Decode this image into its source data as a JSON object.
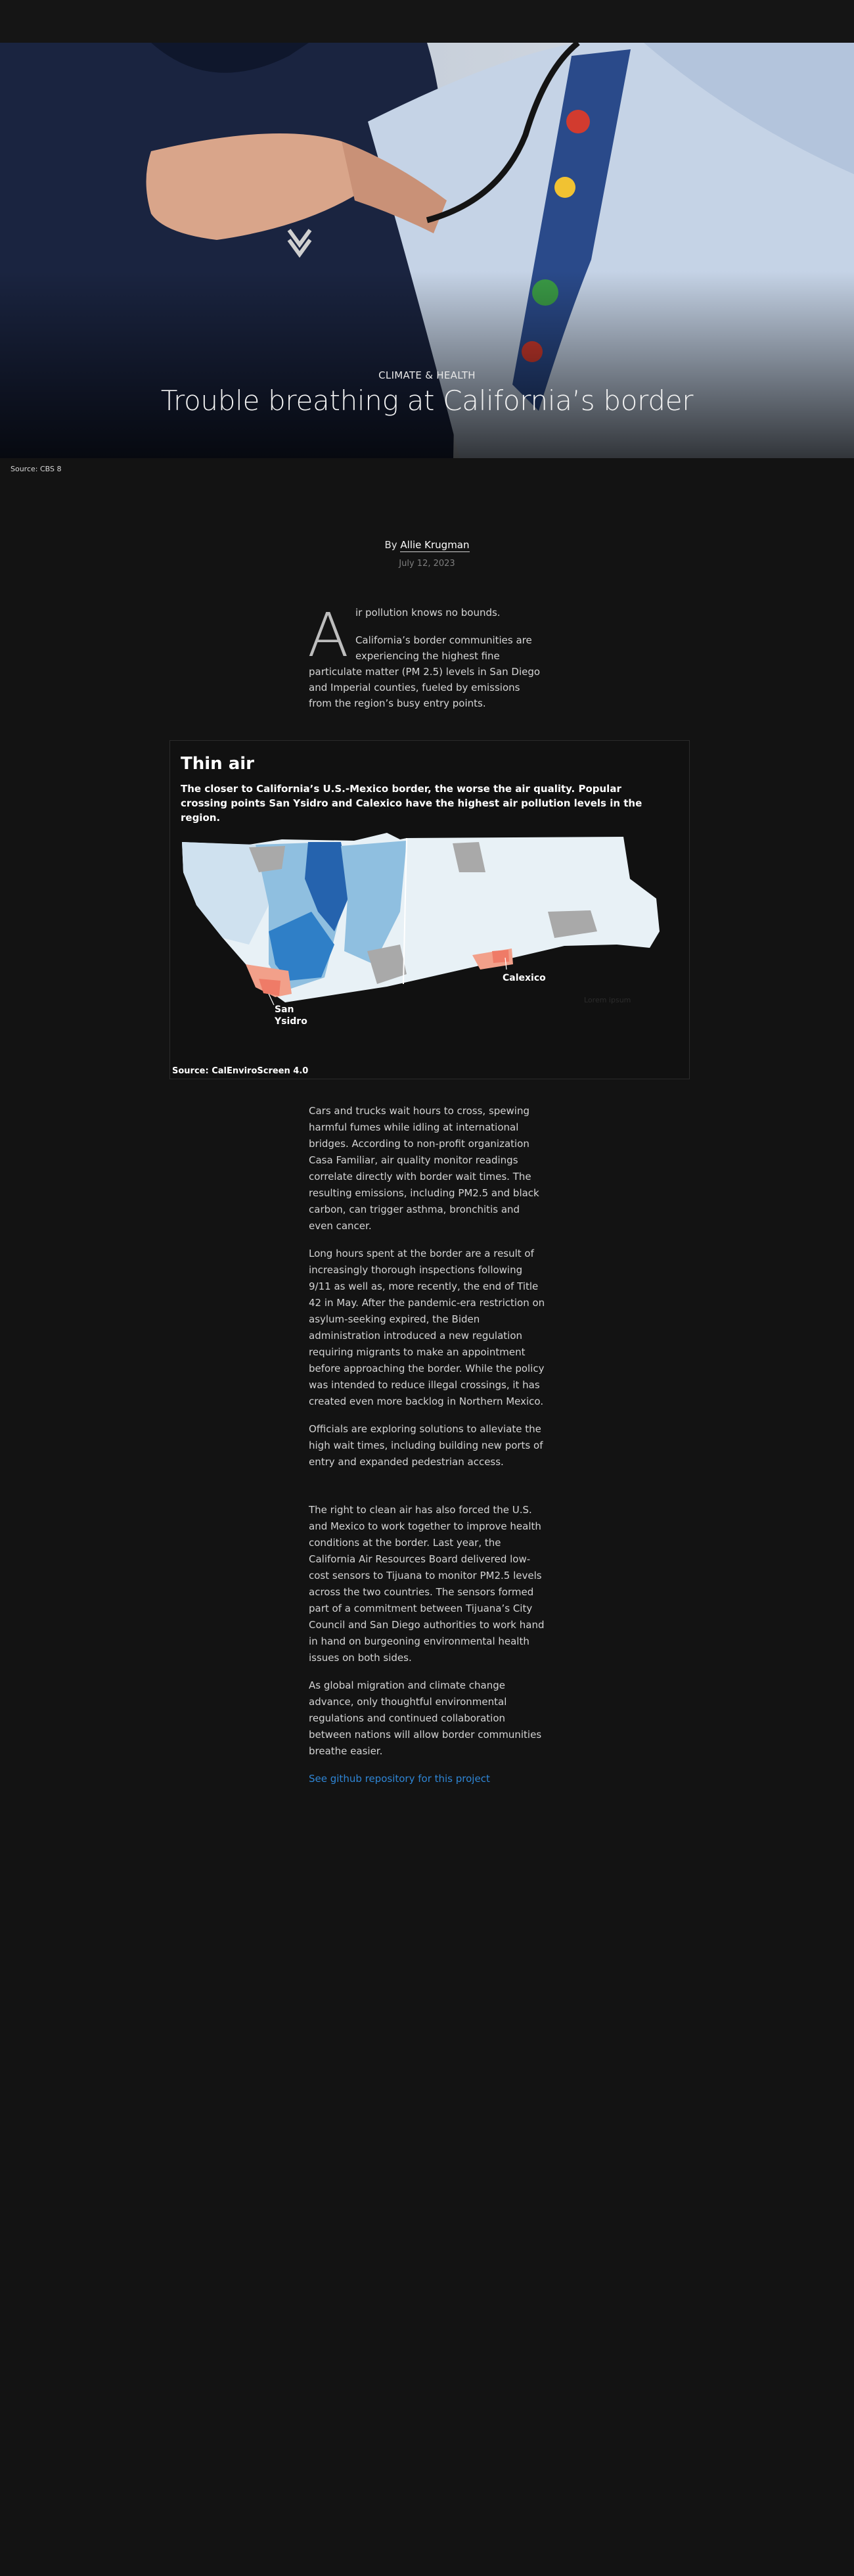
{
  "hero": {
    "kicker": "CLIMATE & HEALTH",
    "headline": "Trouble breathing at California’s border",
    "credit": "Source: CBS 8"
  },
  "byline": {
    "prefix": "By ",
    "author": "Allie Krugman",
    "date": "July 12, 2023"
  },
  "intro": {
    "dropcap": "A",
    "lead": "ir pollution knows no bounds.",
    "paragraph": "California’s border communities are experiencing the highest fine particulate matter (PM 2.5) levels in San Diego and Imperial counties, fueled by emissions from the region’s busy entry points."
  },
  "graphic": {
    "title": "Thin air",
    "subtitle": "The closer to California’s U.S.-Mexico border, the worse the air quality. Popular crossing points San Ysidro and Calexico have the highest air pollution levels in the region.",
    "labels": {
      "calexico": "Calexico",
      "san_ysidro": "San Ysidro"
    },
    "faint_label": "Lorem ipsum",
    "source": "Source: CalEnviroScreen 4.0",
    "colors": {
      "very_light": "#e8f1f6",
      "light": "#cfe1ef",
      "mid": "#8fbfe0",
      "dark": "#2f7fc7",
      "darkest": "#2563ae",
      "nodata": "#a9a9a9",
      "high": "#f2a08a",
      "highest": "#ef7b67"
    }
  },
  "body": {
    "p1": "Cars and trucks wait hours to cross, spewing harmful fumes while idling at international bridges. According to non-profit organization Casa Familiar, air quality monitor readings correlate directly with border wait times. The resulting emissions, including PM2.5 and black carbon, can trigger asthma, bronchitis and even cancer.",
    "p2": "Long hours spent at the border are a result of increasingly thorough inspections following 9/11 as well as, more recently, the end of Title 42 in May. After the pandemic-era restriction on asylum-seeking expired, the Biden administration introduced a new regulation requiring migrants to make an appointment before approaching the border. While the policy was intended to reduce illegal crossings, it has created even more backlog in Northern Mexico.",
    "p3": "Officials are exploring solutions to alleviate the high wait times, including building new ports of entry and expanded pedestrian access.",
    "p4": "The right to clean air has also forced the U.S. and Mexico to work together to improve health conditions at the border. Last year, the California Air Resources Board delivered low-cost sensors to Tijuana to monitor PM2.5 levels across the two countries. The sensors formed part of a commitment between Tijuana’s City Council and San Diego authorities to work hand in hand on burgeoning environmental health issues on both sides.",
    "p5": "As global migration and climate change advance, only thoughtful environmental regulations and continued collaboration between nations will allow border communities breathe easier.",
    "link": "See github repository for this project"
  }
}
